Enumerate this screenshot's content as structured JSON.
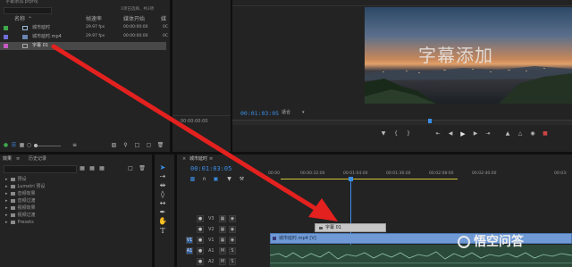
{
  "project": {
    "path": "字幕添加.prproj",
    "item_count": "1项已选择，共3项",
    "columns": [
      "名称",
      "帧速率",
      "媒体开始",
      "媒"
    ],
    "items": [
      {
        "name": "城市延时",
        "fps": "29.97 fps",
        "start": "00:00:00:00",
        "extra": "0C",
        "color": "#3ea84a"
      },
      {
        "name": "城市延时.mp4",
        "fps": "29.97 fps",
        "start": "00:00:00:00",
        "extra": "0C",
        "color": "#6e6ed8"
      },
      {
        "name": "字幕 01",
        "fps": "",
        "start": "",
        "extra": "",
        "color": "#c55ac5"
      }
    ]
  },
  "effects": {
    "tabs": [
      "效果",
      "历史记录"
    ],
    "items": [
      "预设",
      "Lumetri 预设",
      "音频效果",
      "音频过渡",
      "视频效果",
      "视频过渡",
      "Presets"
    ]
  },
  "source_monitor": {
    "timecode": "00:00:00:00"
  },
  "program": {
    "overlay_text": "字幕添加",
    "timecode": "00:01:03:05",
    "zoom": "适合",
    "sky_top": "#3f5672",
    "sky_glow": "#d9925a"
  },
  "timeline": {
    "tab": "城市延时",
    "timecode": "00:01:03:05",
    "ruler_ticks": [
      "00:00",
      "00:00:32:00",
      "00:01:04:00",
      "00:01:36:00",
      "00:02:08:00",
      "00:02:40:00",
      "00:03:"
    ],
    "tracks": [
      {
        "label": "V3",
        "src": ""
      },
      {
        "label": "V2",
        "src": ""
      },
      {
        "label": "V1",
        "src": "V1"
      },
      {
        "label": "A1",
        "src": "A1"
      },
      {
        "label": "A2",
        "src": ""
      }
    ],
    "clips": {
      "subtitle": "字幕 01",
      "video": "城市延时.mp4 [V]"
    }
  },
  "watermark": {
    "text": "悟空问答"
  },
  "colors": {
    "accent_blue": "#3c8ee6",
    "arrow_red": "#e3211f",
    "video_clip": "#6f9ad6"
  }
}
